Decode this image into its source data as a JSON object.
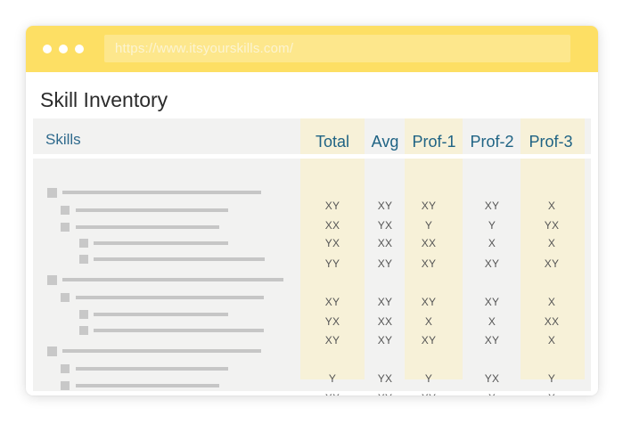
{
  "browser": {
    "url": "https://www.itsyourskills.com/"
  },
  "page": {
    "title": "Skill Inventory"
  },
  "table": {
    "skills_header": "Skills",
    "columns": [
      "Total",
      "Avg",
      "Prof-1",
      "Prof-2",
      "Prof-3"
    ],
    "rows": [
      [
        "XY",
        "XY",
        "XY",
        "XY",
        "X"
      ],
      [
        "XX",
        "YX",
        "Y",
        "Y",
        "YX"
      ],
      [
        "YX",
        "XX",
        "XX",
        "X",
        "X"
      ],
      [
        "YY",
        "XY",
        "XY",
        "XY",
        "XY"
      ],
      [
        "XY",
        "XY",
        "XY",
        "XY",
        "X"
      ],
      [
        "YX",
        "XX",
        "X",
        "X",
        "XX"
      ],
      [
        "XY",
        "XY",
        "XY",
        "XY",
        "X"
      ],
      [
        "Y",
        "YX",
        "Y",
        "YX",
        "Y"
      ],
      [
        "XX",
        "XY",
        "XY",
        "X",
        "X"
      ]
    ]
  },
  "colors": {
    "titlebar": "#fddf64",
    "urlbar": "#fde78c",
    "header_text": "#1f6384",
    "column_band": "#f7f1d8",
    "panel": "#f2f2f1"
  }
}
